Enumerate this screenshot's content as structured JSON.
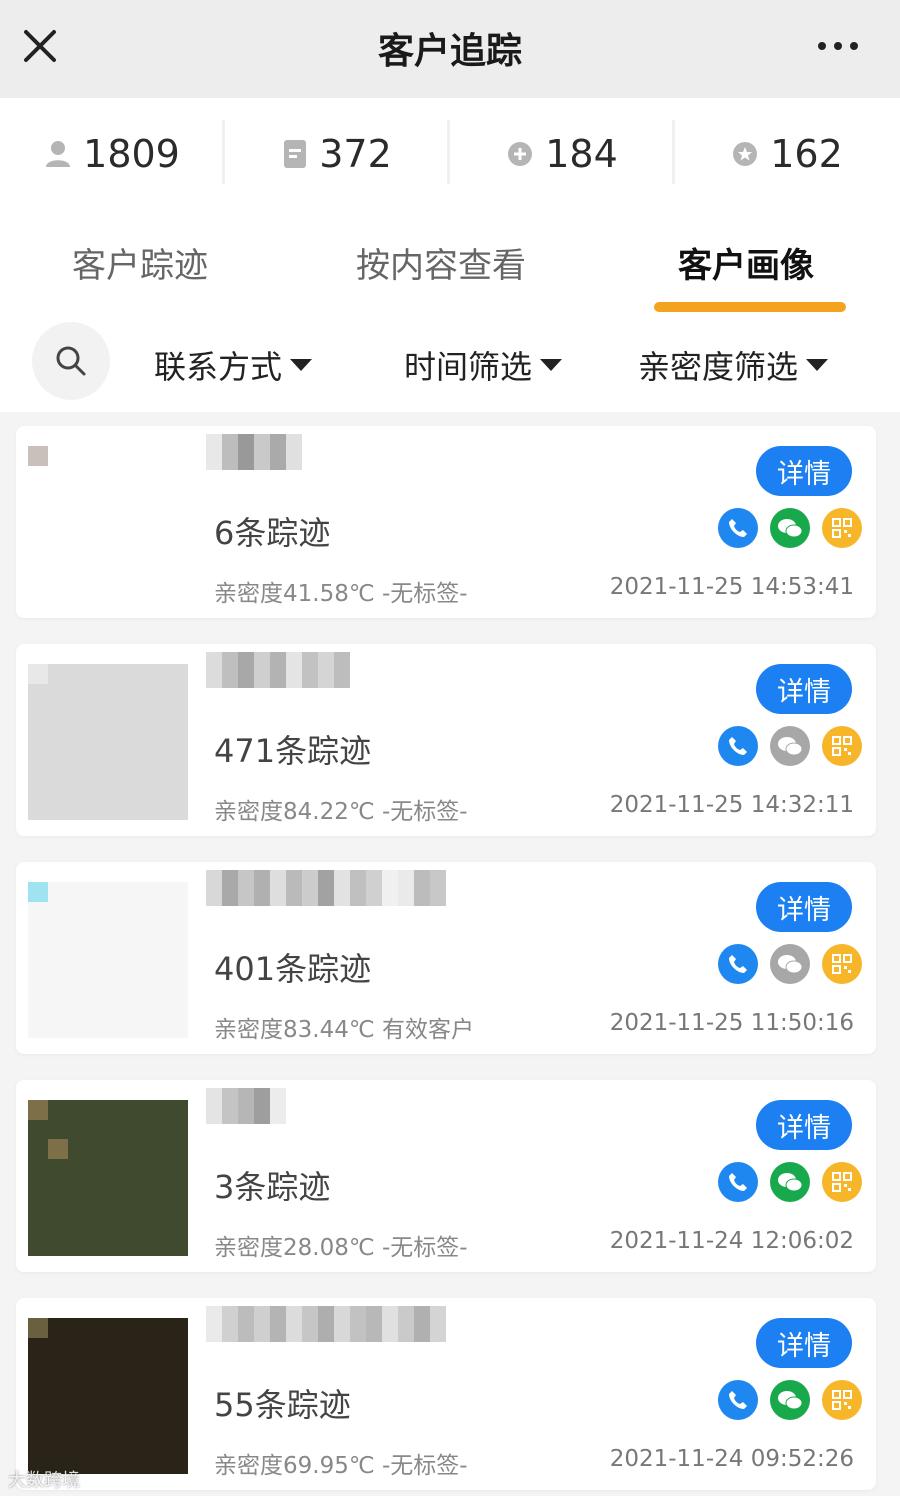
{
  "header": {
    "title": "客户追踪",
    "close_icon": "close-icon",
    "more_icon": "more-icon"
  },
  "stats": [
    {
      "icon": "user-icon",
      "value": "1809"
    },
    {
      "icon": "document-icon",
      "value": "372"
    },
    {
      "icon": "plus-circle-icon",
      "value": "184"
    },
    {
      "icon": "star-icon",
      "value": "162"
    }
  ],
  "tabs": [
    {
      "label": "客户踪迹",
      "active": false
    },
    {
      "label": "按内容查看",
      "active": false
    },
    {
      "label": "客户画像",
      "active": true
    }
  ],
  "filters": [
    {
      "label": "联系方式"
    },
    {
      "label": "时间筛选"
    },
    {
      "label": "亲密度筛选"
    }
  ],
  "accent_color": "#f3a31f",
  "primary_color": "#1c7ff2",
  "customers": [
    {
      "trace": "6条踪迹",
      "meta": "亲密度41.58℃  -无标签-",
      "time": "2021-11-25 14:53:41",
      "detail": "详情",
      "wechat_active": true
    },
    {
      "trace": "471条踪迹",
      "meta": "亲密度84.22℃  -无标签-",
      "time": "2021-11-25 14:32:11",
      "detail": "详情",
      "wechat_active": false
    },
    {
      "trace": "401条踪迹",
      "meta": "亲密度83.44℃  有效客户",
      "time": "2021-11-25 11:50:16",
      "detail": "详情",
      "wechat_active": false
    },
    {
      "trace": "3条踪迹",
      "meta": "亲密度28.08℃  -无标签-",
      "time": "2021-11-24 12:06:02",
      "detail": "详情",
      "wechat_active": true
    },
    {
      "trace": "55条踪迹",
      "meta": "亲密度69.95℃  -无标签-",
      "time": "2021-11-24 09:52:26",
      "detail": "详情",
      "wechat_active": true
    }
  ],
  "watermark": "大数跨境"
}
